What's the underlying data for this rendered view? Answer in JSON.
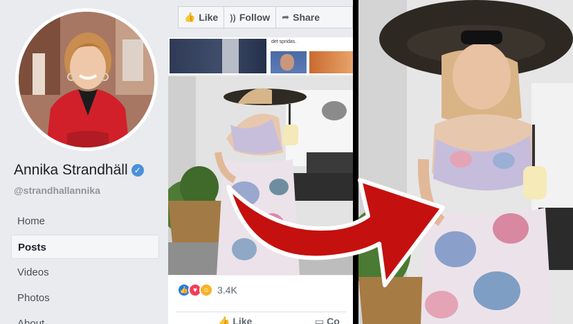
{
  "page": {
    "name": "Annika Strandhäll",
    "handle": "@strandhallannika",
    "verified_icon": "verified-badge-icon"
  },
  "nav": {
    "items": [
      {
        "label": "Home"
      },
      {
        "label": "Posts"
      },
      {
        "label": "Videos"
      },
      {
        "label": "Photos"
      },
      {
        "label": "About"
      }
    ],
    "active": "Posts"
  },
  "actions": {
    "like": "Like",
    "follow": "Follow",
    "share": "Share"
  },
  "thumbs": {
    "caption": "det spridas."
  },
  "post": {
    "reaction_count": "3.4K",
    "reactions": [
      "like-icon",
      "love-icon",
      "care-icon"
    ],
    "like_label": "Like",
    "comment_label": "Co"
  },
  "colors": {
    "facebook_blue": "#4a90d9",
    "arrow_red": "#c4100f",
    "sidebar_bg": "#e9ebee"
  }
}
